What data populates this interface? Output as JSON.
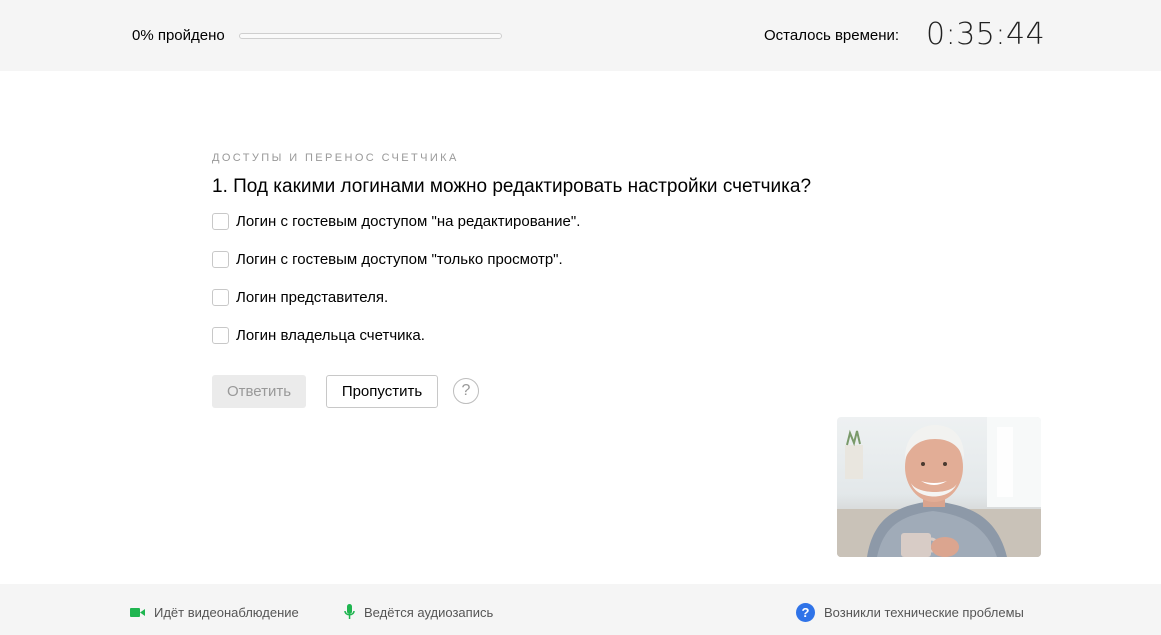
{
  "header": {
    "progress_label": "0% пройдено",
    "progress_value": 0,
    "timer_label": "Осталось времени:",
    "timer_value": "0:35:44"
  },
  "question": {
    "section": "ДОСТУПЫ И ПЕРЕНОС СЧЕТЧИКА",
    "text": "1. Под какими логинами можно редактировать настройки счетчика?",
    "options": [
      {
        "label": "Логин с гостевым доступом \"на редактирование\".",
        "checked": false
      },
      {
        "label": "Логин с гостевым доступом \"только просмотр\".",
        "checked": false
      },
      {
        "label": "Логин представителя.",
        "checked": false
      },
      {
        "label": "Логин владельца счетчика.",
        "checked": false
      }
    ]
  },
  "actions": {
    "answer_label": "Ответить",
    "skip_label": "Пропустить",
    "help_label": "?"
  },
  "footer": {
    "video_label": "Идёт видеонаблюдение",
    "audio_label": "Ведётся аудиозапись",
    "tech_label": "Возникли технические проблемы",
    "tech_icon_glyph": "?",
    "video_icon": "video-camera-icon",
    "audio_icon": "microphone-icon",
    "tech_icon": "help-circle-icon"
  },
  "colors": {
    "progress_fill": "#ffdb4d",
    "recording_green": "#1fb550",
    "help_blue": "#2f73e8"
  }
}
